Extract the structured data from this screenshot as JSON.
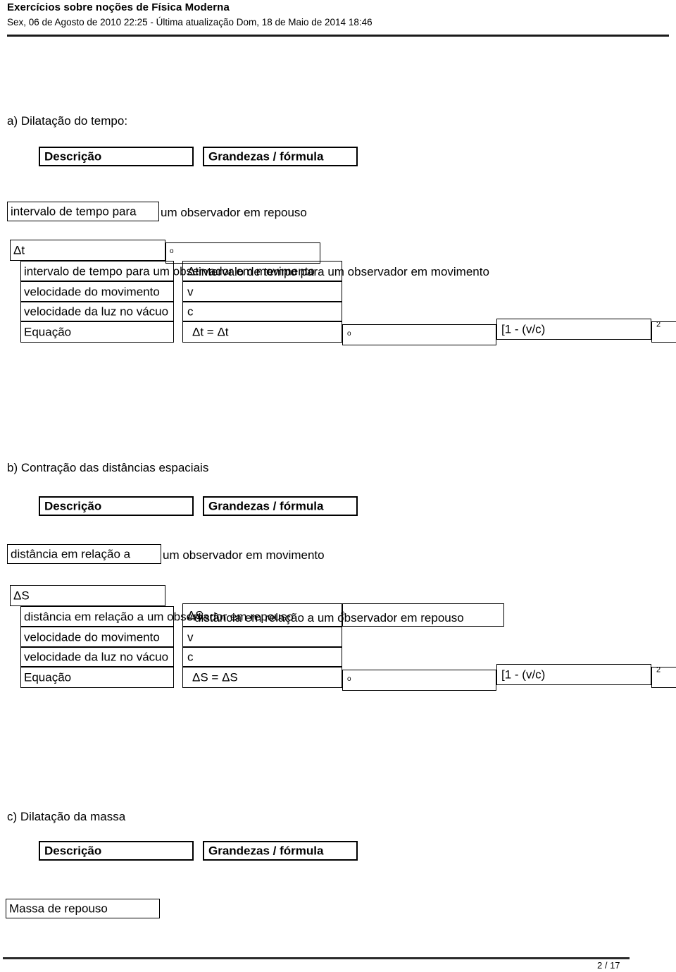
{
  "header": {
    "title": "Exercícios sobre noções de Física Moderna",
    "subtitle": "Sex, 06 de Agosto de 2010 22:25 - Última atualização Dom, 18 de Maio de 2014 18:46"
  },
  "footer": {
    "page_number": "2 / 17"
  },
  "table_headers": {
    "descricao": "Descrição",
    "grandezas": "Grandezas / fórmula"
  },
  "common": {
    "velocidade_movimento": "velocidade do movimento",
    "velocidade_luz": "velocidade da luz no vácuo",
    "equacao": "Equação",
    "symbol_v": "v",
    "symbol_c": "c",
    "bracket_expr": "[1 - (v/c)",
    "exponent": "2",
    "subscript_o": "o"
  },
  "sections": [
    {
      "id": "a",
      "heading": "a) Dilatação do tempo:",
      "row_repouso_boxed": "intervalo de tempo para",
      "row_repouso_overflow": "um observador em repouso",
      "symbol_main": "Δt",
      "row_movimento_boxed": "intervalo de tempo para um observador em movimento",
      "symbol_movimento": "Δt",
      "equation_lhs": "Δt = Δt"
    },
    {
      "id": "b",
      "heading": "b) Contração das distâncias espaciais",
      "row_repouso_boxed": "distância em relação a",
      "row_repouso_overflow": "um observador em movimento",
      "symbol_main": "ΔS",
      "row_movimento_boxed": "distância em relação a um observador em repouso",
      "symbol_movimento": "ΔS",
      "equation_lhs": "ΔS = ΔS"
    },
    {
      "id": "c",
      "heading": "c) Dilatação da massa",
      "row_massa_boxed": "Massa de repouso"
    }
  ]
}
